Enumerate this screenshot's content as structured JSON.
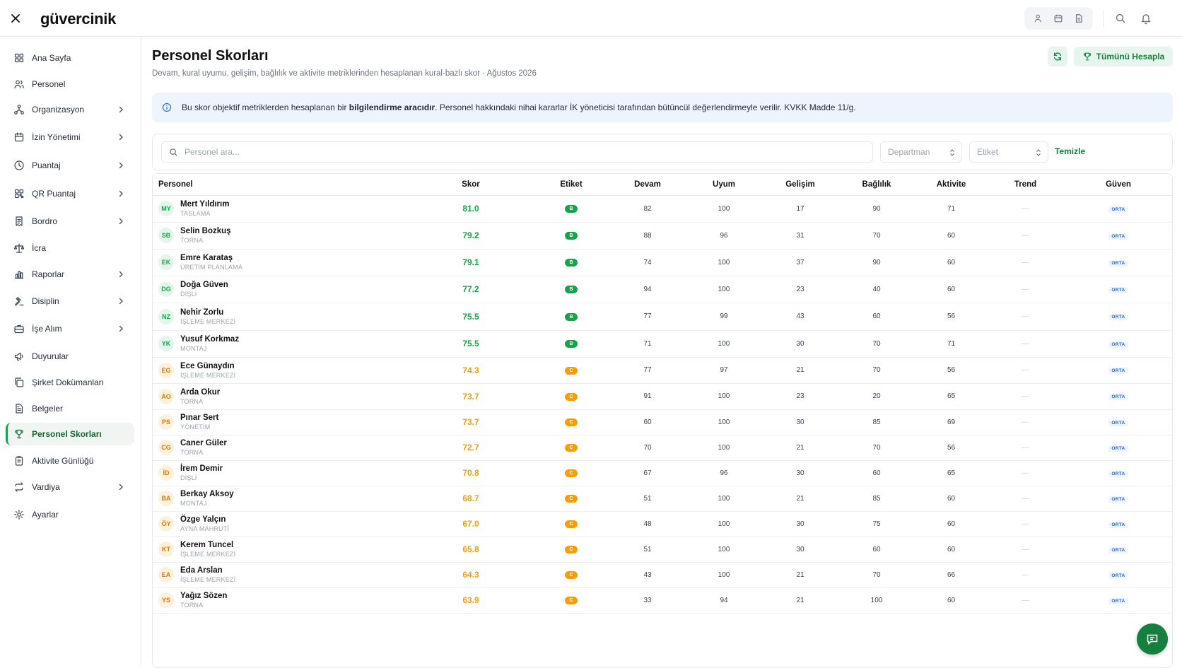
{
  "app": {
    "logo": "güvercinik"
  },
  "sidebar": {
    "items": [
      {
        "label": "Ana Sayfa",
        "icon": "grid-icon",
        "chevron": false
      },
      {
        "label": "Personel",
        "icon": "users-icon",
        "chevron": false
      },
      {
        "label": "Organizasyon",
        "icon": "org-icon",
        "chevron": true
      },
      {
        "label": "İzin Yönetimi",
        "icon": "calendar-icon",
        "chevron": true
      },
      {
        "label": "Puantaj",
        "icon": "clock-icon",
        "chevron": true
      },
      {
        "label": "QR Puantaj",
        "icon": "qr-icon",
        "chevron": true
      },
      {
        "label": "Bordro",
        "icon": "receipt-icon",
        "chevron": true
      },
      {
        "label": "İcra",
        "icon": "scale-icon",
        "chevron": false
      },
      {
        "label": "Raporlar",
        "icon": "bar-chart-icon",
        "chevron": true
      },
      {
        "label": "Disiplin",
        "icon": "gavel-icon",
        "chevron": true
      },
      {
        "label": "İşe Alım",
        "icon": "briefcase-icon",
        "chevron": true
      },
      {
        "label": "Duyurular",
        "icon": "megaphone-icon",
        "chevron": false
      },
      {
        "label": "Şirket Dokümanları",
        "icon": "copy-icon",
        "chevron": false
      },
      {
        "label": "Belgeler",
        "icon": "file-icon",
        "chevron": false
      },
      {
        "label": "Personel Skorları",
        "icon": "trophy-icon",
        "chevron": false,
        "active": true
      },
      {
        "label": "Aktivite Günlüğü",
        "icon": "clipboard-icon",
        "chevron": false
      },
      {
        "label": "Vardiya",
        "icon": "repeat-icon",
        "chevron": true
      },
      {
        "label": "Ayarlar",
        "icon": "gear-icon",
        "chevron": false
      }
    ]
  },
  "header": {
    "title": "Personel Skorları",
    "subtitle": "Devam, kural uyumu, gelişim, bağlılık ve aktivite metriklerinden hesaplanan kural-bazlı skor · Ağustos 2026",
    "calc_all_label": "Tümünü Hesapla"
  },
  "notice": {
    "pre": "Bu skor objektif metriklerden hesaplanan bir ",
    "bold": "bilgilendirme aracıdır",
    "post": ". Personel hakkındaki nihai kararlar İK yöneticisi tarafından bütüncül değerlendirmeyle verilir. KVKK Madde 11/g."
  },
  "filters": {
    "search_placeholder": "Personel ara...",
    "department_placeholder": "Departman",
    "tag_placeholder": "Etiket",
    "clear_label": "Temizle"
  },
  "table": {
    "columns": [
      "Personel",
      "Skor",
      "Etiket",
      "Devam",
      "Uyum",
      "Gelişim",
      "Bağlılık",
      "Aktivite",
      "Trend",
      "Güven"
    ],
    "rows": [
      {
        "initials": "MY",
        "name": "Mert Yıldırım",
        "dept": "TASLAMA",
        "score": "81.0",
        "tag": "B",
        "devam": "82",
        "uyum": "100",
        "gelisim": "17",
        "baglilik": "90",
        "aktivite": "71",
        "trend": "—",
        "guven": "ORTA"
      },
      {
        "initials": "SB",
        "name": "Selin Bozkuş",
        "dept": "TORNA",
        "score": "79.2",
        "tag": "B",
        "devam": "88",
        "uyum": "96",
        "gelisim": "31",
        "baglilik": "70",
        "aktivite": "60",
        "trend": "—",
        "guven": "ORTA"
      },
      {
        "initials": "EK",
        "name": "Emre Karataş",
        "dept": "ÜRETİM PLANLAMA",
        "score": "79.1",
        "tag": "B",
        "devam": "74",
        "uyum": "100",
        "gelisim": "37",
        "baglilik": "90",
        "aktivite": "60",
        "trend": "—",
        "guven": "ORTA"
      },
      {
        "initials": "DG",
        "name": "Doğa Güven",
        "dept": "DİŞLİ",
        "score": "77.2",
        "tag": "B",
        "devam": "94",
        "uyum": "100",
        "gelisim": "23",
        "baglilik": "40",
        "aktivite": "60",
        "trend": "—",
        "guven": "ORTA"
      },
      {
        "initials": "NZ",
        "name": "Nehir Zorlu",
        "dept": "İŞLEME MERKEZİ",
        "score": "75.5",
        "tag": "B",
        "devam": "77",
        "uyum": "99",
        "gelisim": "43",
        "baglilik": "60",
        "aktivite": "56",
        "trend": "—",
        "guven": "ORTA"
      },
      {
        "initials": "YK",
        "name": "Yusuf Korkmaz",
        "dept": "MONTAJ",
        "score": "75.5",
        "tag": "B",
        "devam": "71",
        "uyum": "100",
        "gelisim": "30",
        "baglilik": "70",
        "aktivite": "71",
        "trend": "—",
        "guven": "ORTA"
      },
      {
        "initials": "EG",
        "name": "Ece Günaydın",
        "dept": "İŞLEME MERKEZİ",
        "score": "74.3",
        "tag": "C",
        "devam": "77",
        "uyum": "97",
        "gelisim": "21",
        "baglilik": "70",
        "aktivite": "56",
        "trend": "—",
        "guven": "ORTA"
      },
      {
        "initials": "AO",
        "name": "Arda Okur",
        "dept": "TORNA",
        "score": "73.7",
        "tag": "C",
        "devam": "91",
        "uyum": "100",
        "gelisim": "23",
        "baglilik": "20",
        "aktivite": "65",
        "trend": "—",
        "guven": "ORTA"
      },
      {
        "initials": "PS",
        "name": "Pınar Sert",
        "dept": "YÖNETİM",
        "score": "73.7",
        "tag": "C",
        "devam": "60",
        "uyum": "100",
        "gelisim": "30",
        "baglilik": "85",
        "aktivite": "69",
        "trend": "—",
        "guven": "ORTA"
      },
      {
        "initials": "CG",
        "name": "Caner Güler",
        "dept": "TORNA",
        "score": "72.7",
        "tag": "C",
        "devam": "70",
        "uyum": "100",
        "gelisim": "21",
        "baglilik": "70",
        "aktivite": "56",
        "trend": "—",
        "guven": "ORTA"
      },
      {
        "initials": "İD",
        "name": "İrem Demir",
        "dept": "DİŞLİ",
        "score": "70.8",
        "tag": "C",
        "devam": "67",
        "uyum": "96",
        "gelisim": "30",
        "baglilik": "60",
        "aktivite": "65",
        "trend": "—",
        "guven": "ORTA"
      },
      {
        "initials": "BA",
        "name": "Berkay Aksoy",
        "dept": "MONTAJ",
        "score": "68.7",
        "tag": "C",
        "devam": "51",
        "uyum": "100",
        "gelisim": "21",
        "baglilik": "85",
        "aktivite": "60",
        "trend": "—",
        "guven": "ORTA"
      },
      {
        "initials": "ÖY",
        "name": "Özge Yalçın",
        "dept": "AYNA MAHRUTİ",
        "score": "67.0",
        "tag": "C",
        "devam": "48",
        "uyum": "100",
        "gelisim": "30",
        "baglilik": "75",
        "aktivite": "60",
        "trend": "—",
        "guven": "ORTA"
      },
      {
        "initials": "KT",
        "name": "Kerem Tuncel",
        "dept": "İŞLEME MERKEZİ",
        "score": "65.8",
        "tag": "C",
        "devam": "51",
        "uyum": "100",
        "gelisim": "30",
        "baglilik": "60",
        "aktivite": "60",
        "trend": "—",
        "guven": "ORTA"
      },
      {
        "initials": "EA",
        "name": "Eda Arslan",
        "dept": "İŞLEME MERKEZİ",
        "score": "64.3",
        "tag": "C",
        "devam": "43",
        "uyum": "100",
        "gelisim": "21",
        "baglilik": "70",
        "aktivite": "66",
        "trend": "—",
        "guven": "ORTA"
      },
      {
        "initials": "YS",
        "name": "Yağız Sözen",
        "dept": "TORNA",
        "score": "63.9",
        "tag": "C",
        "devam": "33",
        "uyum": "94",
        "gelisim": "21",
        "baglilik": "100",
        "aktivite": "60",
        "trend": "—",
        "guven": "ORTA"
      }
    ]
  },
  "colors": {
    "brand": "#15803d",
    "tag_b": "#16a34a",
    "tag_c": "#f59e0b",
    "info": "#2563eb"
  }
}
